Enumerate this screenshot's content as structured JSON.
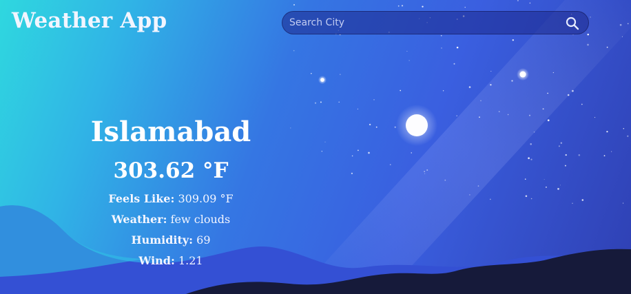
{
  "header": {
    "title": "Weather App"
  },
  "search": {
    "placeholder": "Search City",
    "value": "",
    "icon": "search-icon"
  },
  "weather": {
    "city": "Islamabad",
    "temperature": "303.62 °F",
    "details": {
      "feels_like": {
        "label": "Feels Like:",
        "value": "309.09 °F"
      },
      "condition": {
        "label": "Weather:",
        "value": "few clouds"
      },
      "humidity": {
        "label": "Humidity:",
        "value": "69"
      },
      "wind": {
        "label": "Wind:",
        "value": "1.21"
      }
    }
  },
  "theme": {
    "gradient_start": "#2fd8df",
    "gradient_end": "#2f40b3",
    "hill_back": "#3550d6",
    "hill_front": "#161a3a",
    "text": "#ffffff"
  }
}
